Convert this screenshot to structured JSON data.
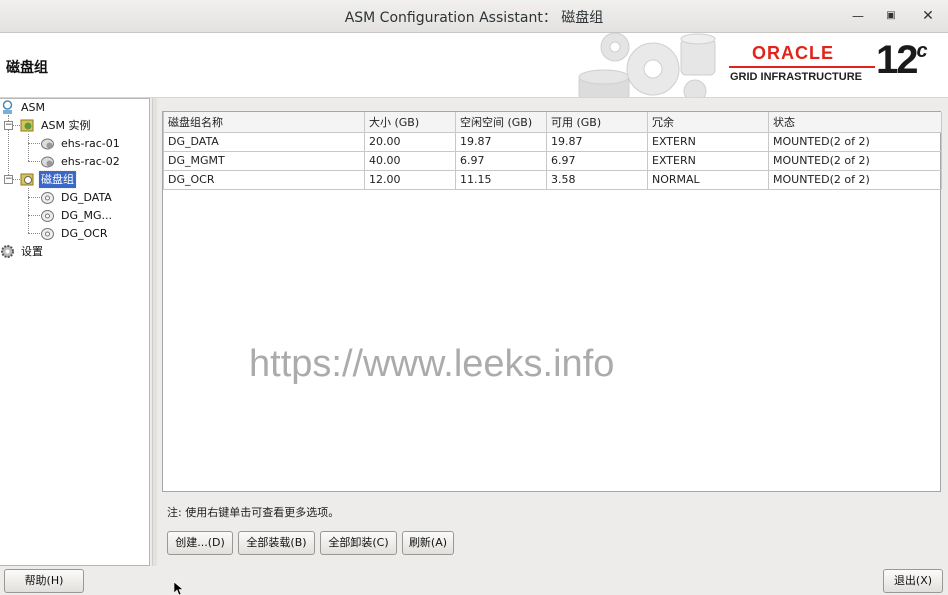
{
  "window": {
    "title": "ASM Configuration Assistant： 磁盘组"
  },
  "banner": {
    "page_title": "磁盘组",
    "brand": "ORACLE",
    "product": "GRID INFRASTRUCTURE",
    "version": "12",
    "version_suffix": "c"
  },
  "tree": {
    "asm": "ASM",
    "asm_instances": "ASM 实例",
    "instances": [
      "ehs-rac-01",
      "ehs-rac-02"
    ],
    "disk_groups": "磁盘组",
    "groups": [
      "DG_DATA",
      "DG_MG...",
      "DG_OCR"
    ],
    "settings": "设置"
  },
  "table": {
    "headers": [
      "磁盘组名称",
      "大小 (GB)",
      "空闲空间 (GB)",
      "可用 (GB)",
      "冗余",
      "状态"
    ],
    "rows": [
      [
        "DG_DATA",
        "20.00",
        "19.87",
        "19.87",
        "EXTERN",
        "MOUNTED(2 of 2)"
      ],
      [
        "DG_MGMT",
        "40.00",
        "6.97",
        "6.97",
        "EXTERN",
        "MOUNTED(2 of 2)"
      ],
      [
        "DG_OCR",
        "12.00",
        "11.15",
        "3.58",
        "NORMAL",
        "MOUNTED(2 of 2)"
      ]
    ]
  },
  "watermark": "https://www.leeks.info",
  "note": "注: 使用右键单击可查看更多选项。",
  "buttons": {
    "create": "创建...(D)",
    "mount_all": "全部装载(B)",
    "dismount_all": "全部卸装(C)",
    "refresh": "刷新(A)",
    "help": "帮助(H)",
    "exit": "退出(X)"
  },
  "colors": {
    "oracle_red": "#e2231a",
    "selection": "#3a67c8"
  }
}
